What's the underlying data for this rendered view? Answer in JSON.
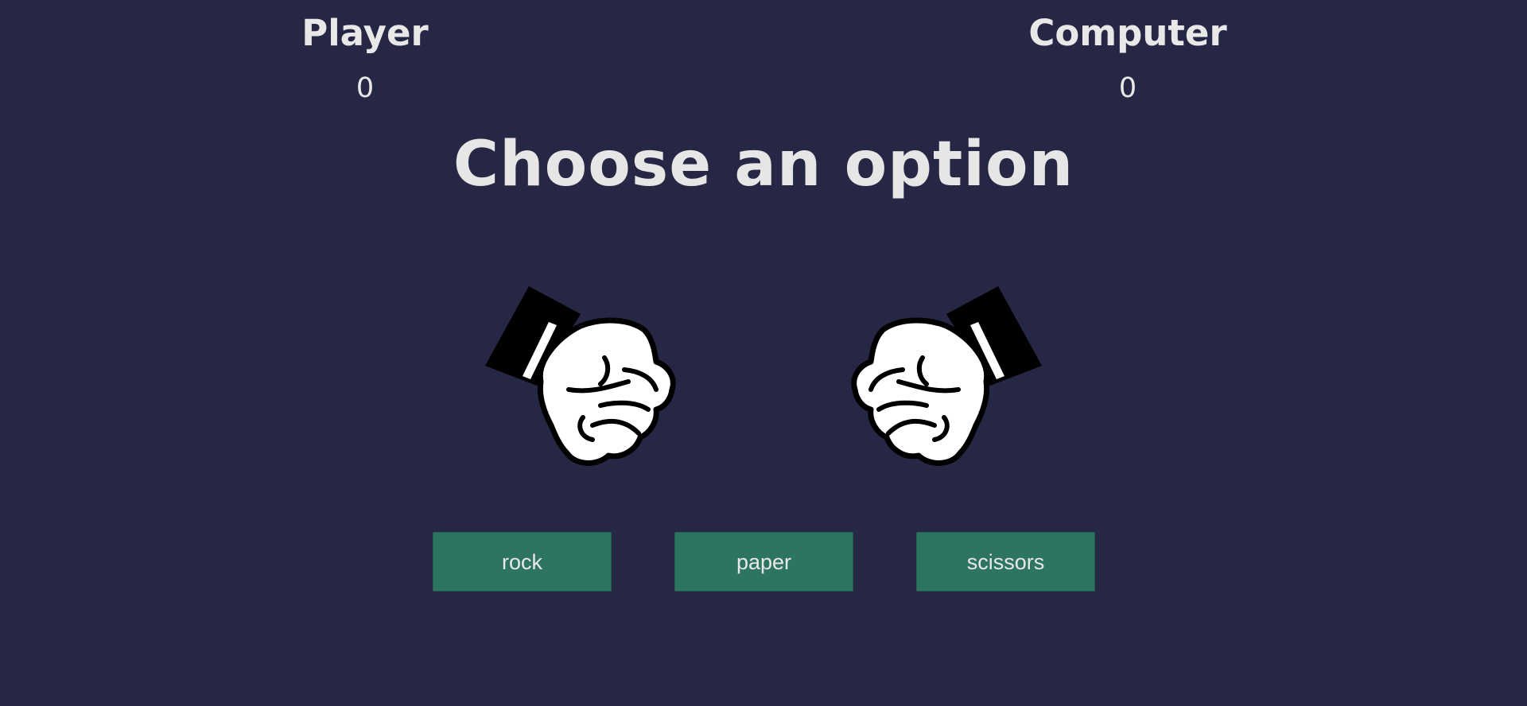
{
  "scoreboard": {
    "player": {
      "label": "Player",
      "score": "0"
    },
    "computer": {
      "label": "Computer",
      "score": "0"
    }
  },
  "prompt": "Choose an option",
  "hands": {
    "player": {
      "icon": "rock-fist-icon"
    },
    "computer": {
      "icon": "rock-fist-icon"
    }
  },
  "choices": [
    {
      "label": "rock"
    },
    {
      "label": "paper"
    },
    {
      "label": "scissors"
    }
  ],
  "colors": {
    "background": "#262745",
    "text": "#e6e6e6",
    "button": "#2d7561"
  }
}
